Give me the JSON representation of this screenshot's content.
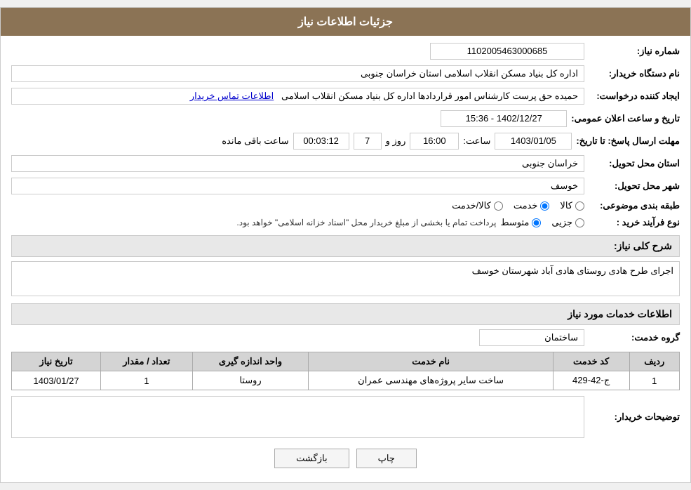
{
  "header": {
    "title": "جزئیات اطلاعات نیاز"
  },
  "fields": {
    "shomareNiaz_label": "شماره نیاز:",
    "shomareNiaz_value": "1102005463000685",
    "namDastgah_label": "نام دستگاه خریدار:",
    "namDastgah_value": "اداره کل بنیاد مسکن انقلاب اسلامی استان خراسان جنوبی",
    "ijadKonande_label": "ایجاد کننده درخواست:",
    "ijadKonande_value": "حمیده حق پرست کارشناس امور قراردادها اداره کل بنیاد مسکن انقلاب اسلامی",
    "ettelaatTamas_label": "اطلاعات تماس خریدار",
    "tarikhLabel": "تاریخ و ساعت اعلان عمومی:",
    "tarikhValue": "1402/12/27 - 15:36",
    "mohlatLabel": "مهلت ارسال پاسخ: تا تاریخ:",
    "mohlatDate": "1403/01/05",
    "mohlatSaat_label": "ساعت:",
    "mohlatSaat": "16:00",
    "mohlatRooz_label": "روز و",
    "mohlatRooz": "7",
    "baghimande_label": "ساعت باقی مانده",
    "baghimande": "00:03:12",
    "ostanLabel": "استان محل تحویل:",
    "ostanValue": "خراسان جنوبی",
    "shahrLabel": "شهر محل تحویل:",
    "shahrValue": "خوسف",
    "tabaqebandi_label": "طبقه بندی موضوعی:",
    "tabaqebandi_options": [
      "کالا",
      "خدمت",
      "کالا/خدمت"
    ],
    "tabaqebandi_selected": "خدمت",
    "noeFarayand_label": "نوع فرآیند خرید :",
    "noeFarayand_options": [
      "جزیی",
      "متوسط"
    ],
    "noeFarayand_note": "پرداخت تمام یا بخشی از مبلغ خریدار محل \"اسناد خزانه اسلامی\" خواهد بود.",
    "sharhLabel": "شرح کلی نیاز:",
    "sharhValue": "اجرای طرح هادی روستای هادی آباد شهرستان خوسف",
    "khadamatLabel": "اطلاعات خدمات مورد نیاز",
    "gerohKhadamat_label": "گروه خدمت:",
    "gerohKhadamat_value": "ساختمان"
  },
  "table": {
    "headers": [
      "ردیف",
      "کد خدمت",
      "نام خدمت",
      "واحد اندازه گیری",
      "تعداد / مقدار",
      "تاریخ نیاز"
    ],
    "rows": [
      {
        "radif": "1",
        "kodKhadamat": "ج-42-429",
        "namKhadamat": "ساخت سایر پروژه‌های مهندسی عمران",
        "vahed": "روستا",
        "tedad": "1",
        "tarikh": "1403/01/27"
      }
    ]
  },
  "description": {
    "label": "توضیحات خریدار:",
    "value": ""
  },
  "buttons": {
    "print": "چاپ",
    "back": "بازگشت"
  }
}
